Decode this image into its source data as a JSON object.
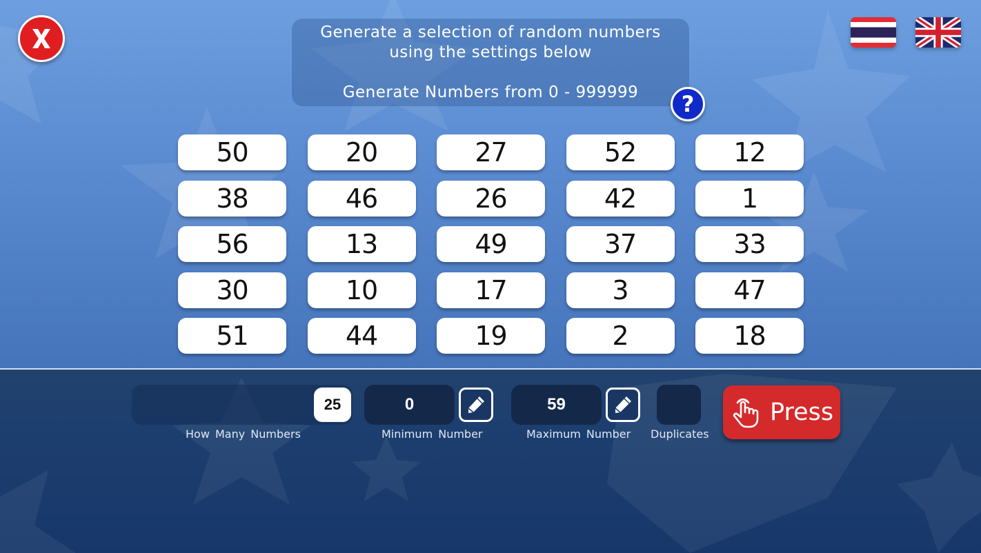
{
  "header": {
    "close_icon": "close-x-icon",
    "info_line1": "Generate a selection of random numbers",
    "info_line2": "using the settings below",
    "info_line3": "Generate Numbers from 0 - 999999",
    "help_label": "?",
    "languages": [
      {
        "name": "Thai",
        "icon": "thai-flag-icon"
      },
      {
        "name": "English",
        "icon": "uk-flag-icon"
      }
    ]
  },
  "numbers": [
    "50",
    "20",
    "27",
    "52",
    "12",
    "38",
    "46",
    "26",
    "42",
    "1",
    "56",
    "13",
    "49",
    "37",
    "33",
    "30",
    "10",
    "17",
    "3",
    "47",
    "51",
    "44",
    "19",
    "2",
    "18"
  ],
  "controls": {
    "how_many": {
      "label": "How Many Numbers",
      "value": "25"
    },
    "minimum": {
      "label": "Minimum Number",
      "value": "0",
      "edit_icon": "pencil-icon"
    },
    "maximum": {
      "label": "Maximum Number",
      "value": "59",
      "edit_icon": "pencil-icon"
    },
    "duplicates": {
      "label": "Duplicates",
      "checked": false
    },
    "press_button": {
      "label": "Press",
      "icon": "tap-hand-icon"
    }
  },
  "colors": {
    "close": "#e01e22",
    "help": "#1029c9",
    "press": "#d42a2b",
    "panel": "#17376a",
    "value_box": "#14284a"
  }
}
